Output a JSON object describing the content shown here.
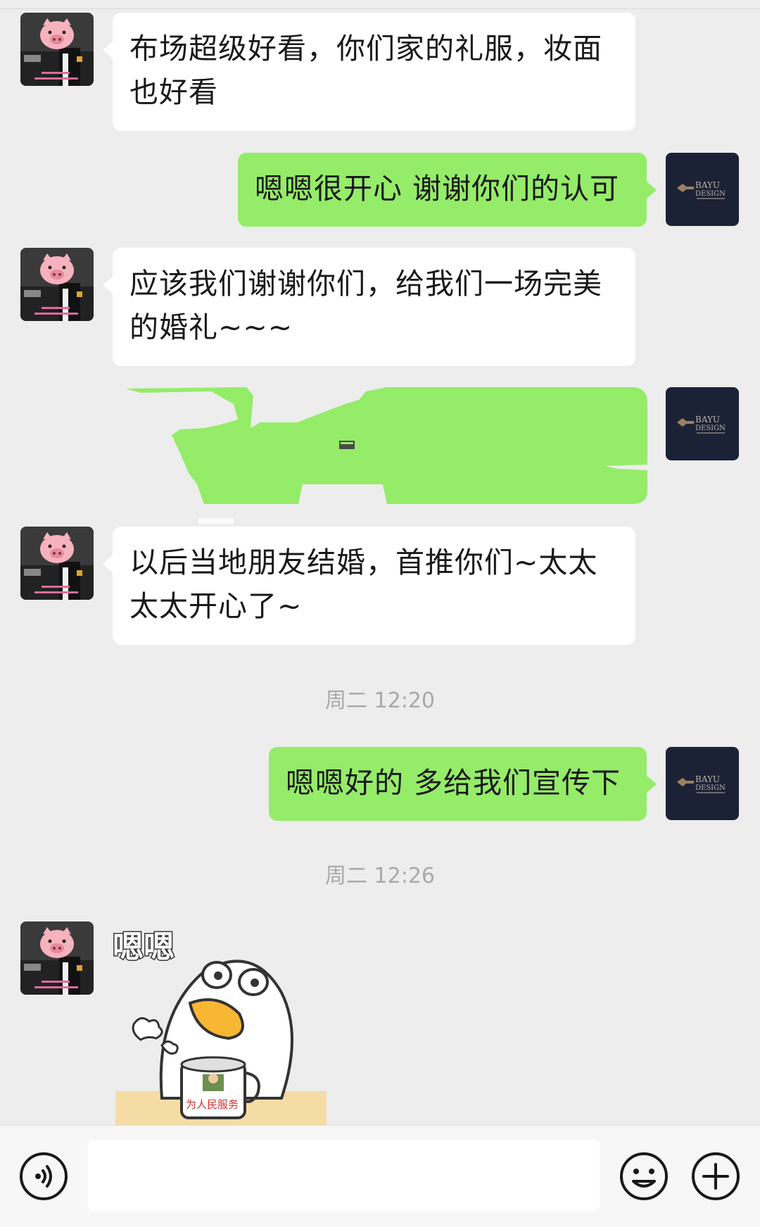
{
  "messages": [
    {
      "side": "in",
      "text": "布场超级好看，你们家的礼服，妆面也好看"
    },
    {
      "side": "out",
      "text": "嗯嗯很开心 谢谢你们的认可"
    },
    {
      "side": "in",
      "text": "应该我们谢谢你们，给我们一场完美的婚礼~~~"
    },
    {
      "side": "out",
      "text": ""
    },
    {
      "side": "in",
      "text": "以后当地朋友结婚，首推你们~太太太太开心了~"
    },
    {
      "side": "out",
      "text": "嗯嗯好的 多给我们宣传下"
    }
  ],
  "timestamps": [
    "周二 12:20",
    "周二 12:26"
  ],
  "sticker": {
    "text": "嗯嗯",
    "mug_text": "为人民服务"
  },
  "input": {
    "placeholder": "",
    "value": ""
  },
  "icons": {
    "voice": "voice-icon",
    "emoji": "emoji-icon",
    "plus": "plus-icon"
  },
  "colors": {
    "background": "#ededed",
    "outgoing_bubble": "#95ec69",
    "incoming_bubble": "#ffffff",
    "timestamp": "#a9a9a9"
  }
}
